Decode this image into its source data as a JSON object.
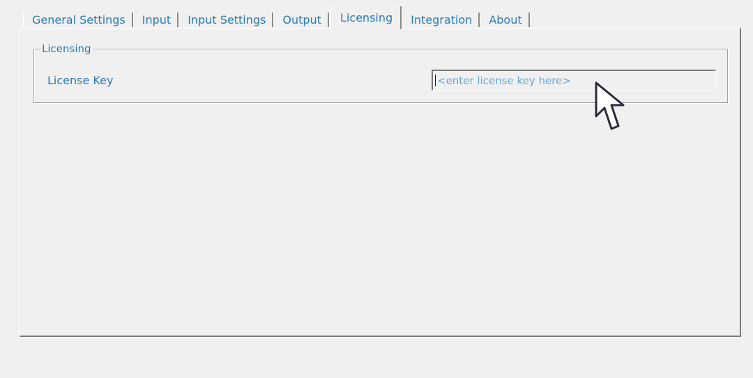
{
  "tabs": [
    {
      "label": "General Settings"
    },
    {
      "label": "Input"
    },
    {
      "label": "Input Settings"
    },
    {
      "label": "Output"
    },
    {
      "label": "Licensing"
    },
    {
      "label": "Integration"
    },
    {
      "label": "About"
    }
  ],
  "selected_tab": "Licensing",
  "licensing": {
    "group_title": "Licensing",
    "license_key_label": "License Key",
    "license_key_value": "",
    "license_key_placeholder": "<enter license key here>"
  },
  "icons": {
    "cursor": "arrow-cursor-icon"
  },
  "colors": {
    "label_text": "#2a7ab0",
    "placeholder_text": "#6aa8cf",
    "background": "#f0f0f0"
  }
}
